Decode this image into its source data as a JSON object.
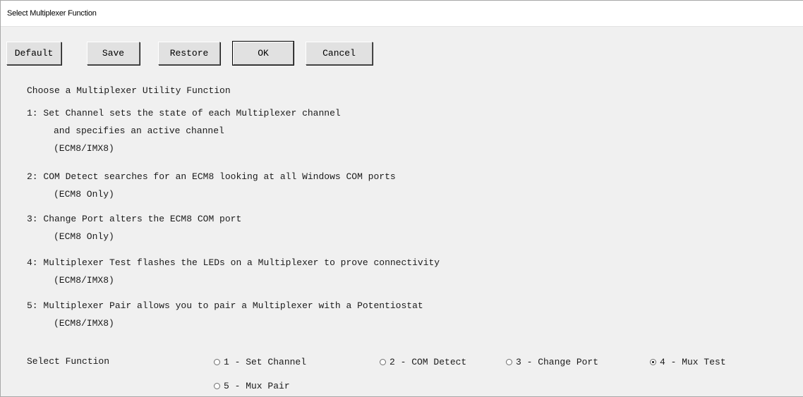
{
  "window": {
    "title": "Select Multiplexer Function"
  },
  "toolbar": {
    "default_label": "Default",
    "save_label": "Save",
    "restore_label": "Restore",
    "ok_label": "OK",
    "cancel_label": "Cancel"
  },
  "content": {
    "heading": "Choose a Multiplexer Utility Function",
    "items": [
      {
        "line1": "1: Set Channel sets the state of each Multiplexer channel",
        "line2": "and specifies an active channel",
        "line3": "(ECM8/IMX8)"
      },
      {
        "line1": "2: COM Detect searches for an ECM8 looking at all Windows COM ports",
        "line2": "(ECM8 Only)"
      },
      {
        "line1": "3: Change Port alters the ECM8 COM port",
        "line2": "(ECM8 Only)"
      },
      {
        "line1": "4: Multiplexer Test flashes the LEDs on a Multiplexer to prove connectivity",
        "line2": "(ECM8/IMX8)"
      },
      {
        "line1": "5: Multiplexer Pair allows you to pair a Multiplexer with a Potentiostat",
        "line2": "(ECM8/IMX8)"
      }
    ]
  },
  "select_function": {
    "label": "Select Function",
    "selected": "4 - Mux Test",
    "options": [
      {
        "label": "1 - Set Channel",
        "checked": false
      },
      {
        "label": "2 - COM Detect",
        "checked": false
      },
      {
        "label": "3 - Change Port",
        "checked": false
      },
      {
        "label": "4 - Mux Test",
        "checked": true
      },
      {
        "label": "5 - Mux Pair",
        "checked": false
      }
    ]
  }
}
